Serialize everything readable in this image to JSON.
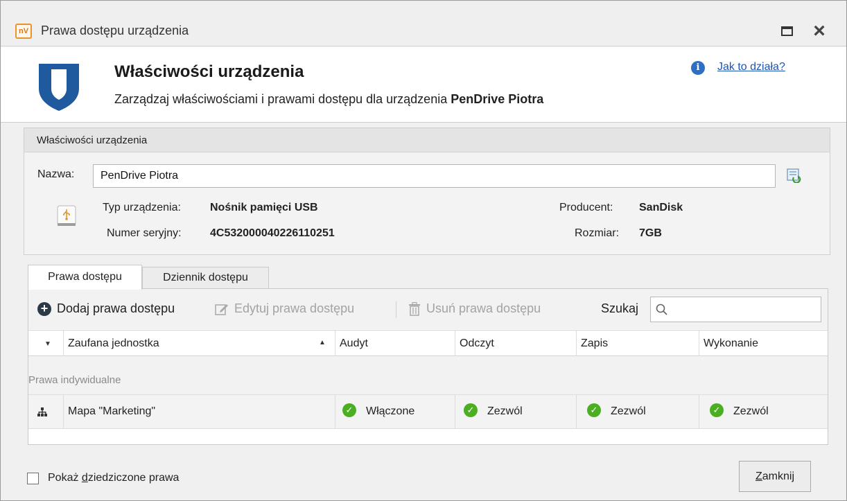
{
  "window": {
    "title": "Prawa dostępu urządzenia",
    "logo_text": "nV"
  },
  "header": {
    "title": "Właściwości urządzenia",
    "subtitle_prefix": "Zarządzaj właściwościami i prawami dostępu dla urządzenia ",
    "subtitle_device": "PenDrive Piotra",
    "help_link": "Jak to działa?"
  },
  "properties": {
    "group_title": "Właściwości urządzenia",
    "name_label": "Nazwa:",
    "name_value": "PenDrive Piotra",
    "device_type_label": "Typ urządzenia:",
    "device_type_value": "Nośnik pamięci USB",
    "serial_label": "Numer seryjny:",
    "serial_value": "4C532000040226110251",
    "vendor_label": "Producent:",
    "vendor_value": "SanDisk",
    "size_label": "Rozmiar:",
    "size_value": "7GB"
  },
  "tabs": [
    {
      "label": "Prawa dostępu",
      "active": true
    },
    {
      "label": "Dziennik dostępu",
      "active": false
    }
  ],
  "toolbar": {
    "add_label": "Dodaj prawa dostępu",
    "edit_label": "Edytuj prawa dostępu",
    "delete_label": "Usuń prawa dostępu",
    "search_label": "Szukaj",
    "search_value": ""
  },
  "grid": {
    "columns": [
      "Zaufana jednostka",
      "Audyt",
      "Odczyt",
      "Zapis",
      "Wykonanie"
    ],
    "group_label": "Prawa indywidualne",
    "rows": [
      {
        "entity": "Mapa \"Marketing\"",
        "audit": "Włączone",
        "read": "Zezwól",
        "write": "Zezwól",
        "execute": "Zezwól"
      }
    ]
  },
  "footer": {
    "show_inherited_prefix": "Pokaż ",
    "show_inherited_underlined": "d",
    "show_inherited_suffix": "ziedziczone prawa",
    "show_inherited_checked": false,
    "close_underlined": "Z",
    "close_rest": "amknij"
  },
  "colors": {
    "accent_blue": "#1a55b5",
    "shield_blue": "#1f5a9e",
    "check_green": "#4caf22",
    "logo_orange": "#e8932b"
  }
}
